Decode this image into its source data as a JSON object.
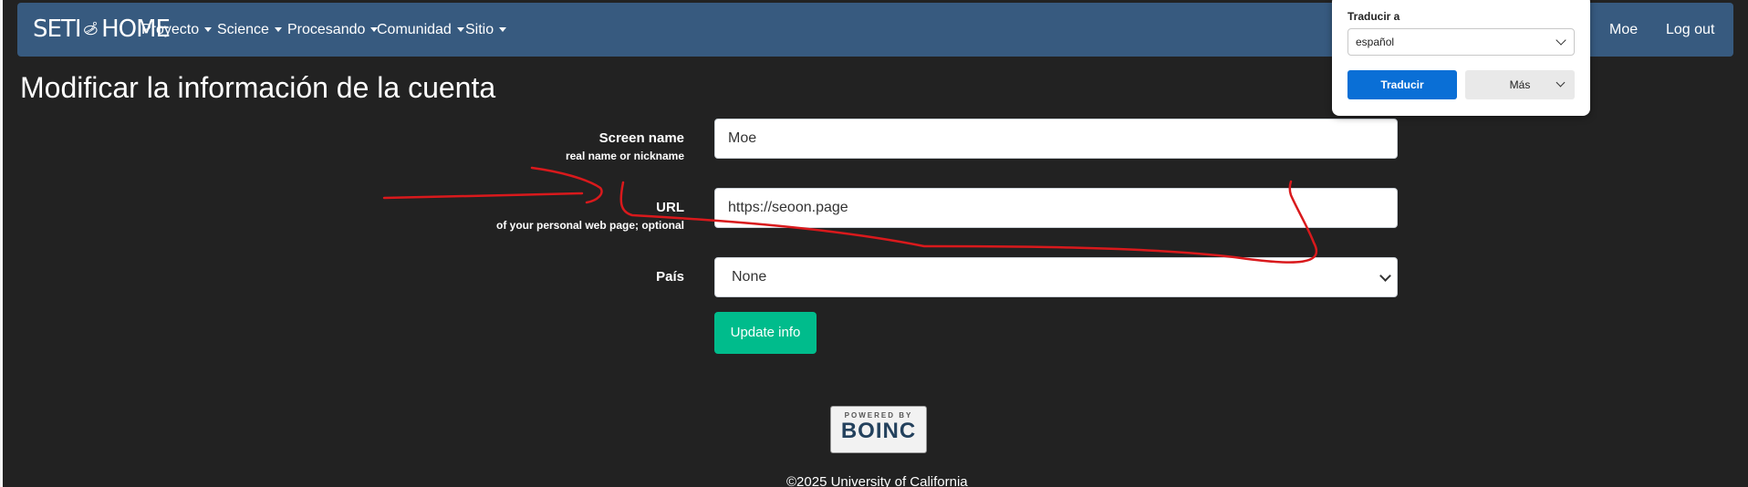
{
  "brand": {
    "left": "SETI",
    "right": "HOME"
  },
  "nav": {
    "items": [
      {
        "label": "Proyecto"
      },
      {
        "label": "Science"
      },
      {
        "label": "Procesando"
      },
      {
        "label": "Comunidad"
      },
      {
        "label": "Sitio"
      }
    ],
    "user": "Moe",
    "logout": "Log out"
  },
  "page_title": "Modificar la información de la cuenta",
  "form": {
    "screen_name": {
      "label": "Screen name",
      "hint": "real name or nickname",
      "value": "Moe"
    },
    "url": {
      "label": "URL",
      "hint": "of your personal web page; optional",
      "value": "https://seoon.page"
    },
    "country": {
      "label": "País",
      "value": "None"
    },
    "submit": "Update info"
  },
  "footer": {
    "badge_top": "POWERED BY",
    "badge_logo": "BOINC",
    "copyright": "©2025 University of California"
  },
  "translate_popup": {
    "label": "Traducir a",
    "language": "español",
    "translate_button": "Traducir",
    "more_button": "Más"
  },
  "colors": {
    "navbar": "#375a7f",
    "background": "#222222",
    "accent": "#00bc8c",
    "annotation": "#d9191c",
    "translate_button": "#0a6fd6"
  }
}
